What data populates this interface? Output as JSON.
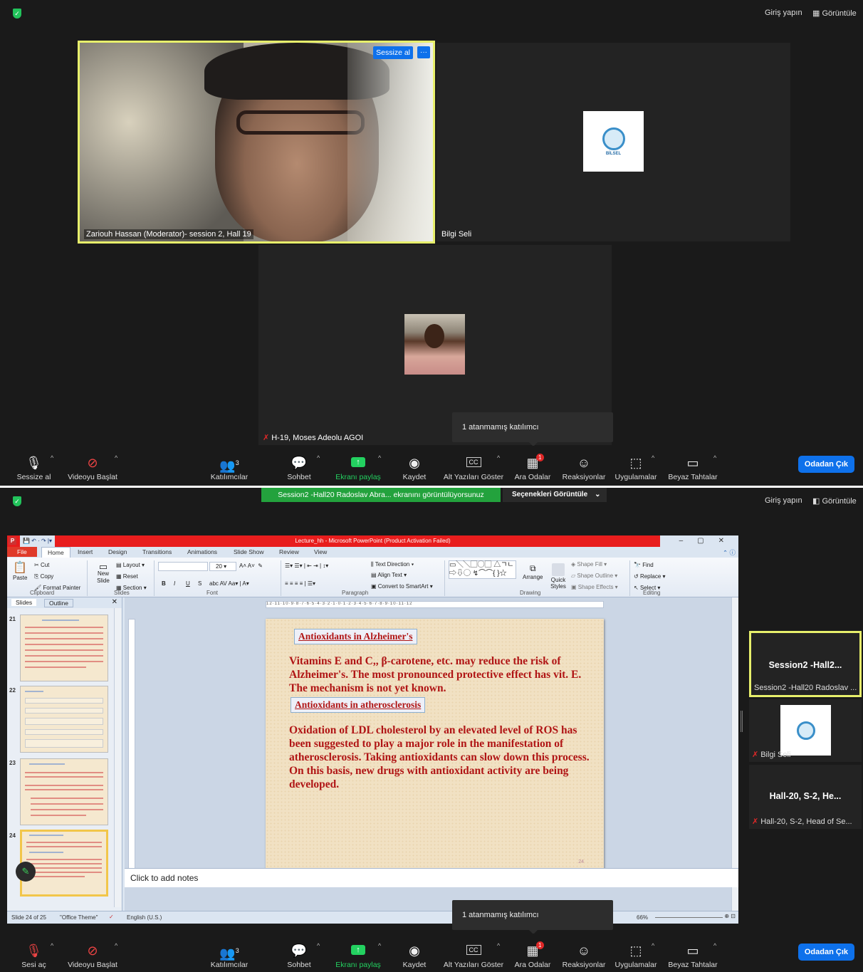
{
  "top": {
    "sign_in": "Giriş yapın",
    "view": "Görüntüle",
    "tiles": [
      {
        "name": "Zariouh Hassan (Moderator)- session 2, Hall 19",
        "mute_button": "Sessize al",
        "more_button": "···"
      },
      {
        "name": "Bilgi Seli",
        "logo_text": "BİLSEL"
      },
      {
        "name": "H-19, Moses Adeolu AGOI"
      }
    ],
    "tooltip": "1 atanmamış katılımcı",
    "toolbar": {
      "mute": "Sessize al",
      "video": "Videoyu Başlat",
      "participants": "Katılımcılar",
      "participants_count": "3",
      "chat": "Sohbet",
      "share": "Ekranı paylaş",
      "record": "Kaydet",
      "captions": "Alt Yazıları Göster",
      "breakout": "Ara Odalar",
      "breakout_badge": "1",
      "reactions": "Reaksiyonlar",
      "apps": "Uygulamalar",
      "whiteboard": "Beyaz Tahtalar",
      "leave": "Odadan Çık"
    }
  },
  "bottom": {
    "sign_in": "Giriş yapın",
    "view": "Görüntüle",
    "share_banner": "Session2 -Hall20 Radoslav Abra... ekranını görüntülüyorsunuz",
    "view_options": "Seçenekleri Görüntüle",
    "ppt": {
      "title": "Lecture_hh - Microsoft PowerPoint (Product Activation Failed)",
      "tabs": [
        "File",
        "Home",
        "Insert",
        "Design",
        "Transitions",
        "Animations",
        "Slide Show",
        "Review",
        "View"
      ],
      "clipboard": {
        "paste": "Paste",
        "cut": "Cut",
        "copy": "Copy",
        "format_painter": "Format Painter",
        "group": "Clipboard"
      },
      "slides_group": {
        "new_slide": "New Slide",
        "layout": "Layout",
        "reset": "Reset",
        "section": "Section",
        "group": "Slides"
      },
      "font_group": {
        "size": "20",
        "group": "Font",
        "bold": "B",
        "italic": "I",
        "underline": "U",
        "strike": "S"
      },
      "paragraph_group": {
        "text_direction": "Text Direction",
        "align_text": "Align Text",
        "convert": "Convert to SmartArt",
        "group": "Paragraph"
      },
      "drawing_group": {
        "arrange": "Arrange",
        "quick_styles": "Quick Styles",
        "shape_fill": "Shape Fill",
        "shape_outline": "Shape Outline",
        "shape_effects": "Shape Effects",
        "group": "Drawing"
      },
      "editing_group": {
        "find": "Find",
        "replace": "Replace",
        "select": "Select",
        "group": "Editing"
      },
      "panel_tabs": [
        "Slides",
        "Outline"
      ],
      "thumb_numbers": [
        "21",
        "22",
        "23",
        "24"
      ],
      "slide": {
        "heading1": "Antioxidants in Alzheimer's",
        "para1": "Vitamins E and C,, β-carotene, etc. may reduce the risk of Alzheimer's. The most pronounced protective effect has vit. E. The mechanism is not yet known.",
        "heading2": "Antioxidants in atherosclerosis",
        "para2": "Oxidation of LDL cholesterol by an elevated level of ROS has been suggested to play a major role in the manifestation of atherosclerosis. Taking antioxidants can slow down this process. On this basis, new drugs with antioxidant activity are being developed.",
        "page_number": "24"
      },
      "notes": "Click to add notes",
      "status": {
        "slide": "Slide 24 of 25",
        "theme": "\"Office Theme\"",
        "lang": "English (U.S.)",
        "zoom": "66%"
      }
    },
    "side_tiles": [
      {
        "big": "Session2  -Hall2...",
        "name": "Session2 -Hall20 Radoslav ..."
      },
      {
        "name": "Bilgi Seli"
      },
      {
        "big": "Hall-20, S-2, He...",
        "name": "Hall-20, S-2, Head of Se..."
      }
    ],
    "tooltip": "1 atanmamış katılımcı",
    "toolbar": {
      "mute": "Sesi aç",
      "video": "Videoyu Başlat",
      "participants": "Katılımcılar",
      "participants_count": "3",
      "chat": "Sohbet",
      "share": "Ekranı paylaş",
      "record": "Kaydet",
      "captions": "Alt Yazıları Göster",
      "breakout": "Ara Odalar",
      "breakout_badge": "1",
      "reactions": "Reaksiyonlar",
      "apps": "Uygulamalar",
      "whiteboard": "Beyaz Tahtalar",
      "leave": "Odadan Çık"
    }
  }
}
